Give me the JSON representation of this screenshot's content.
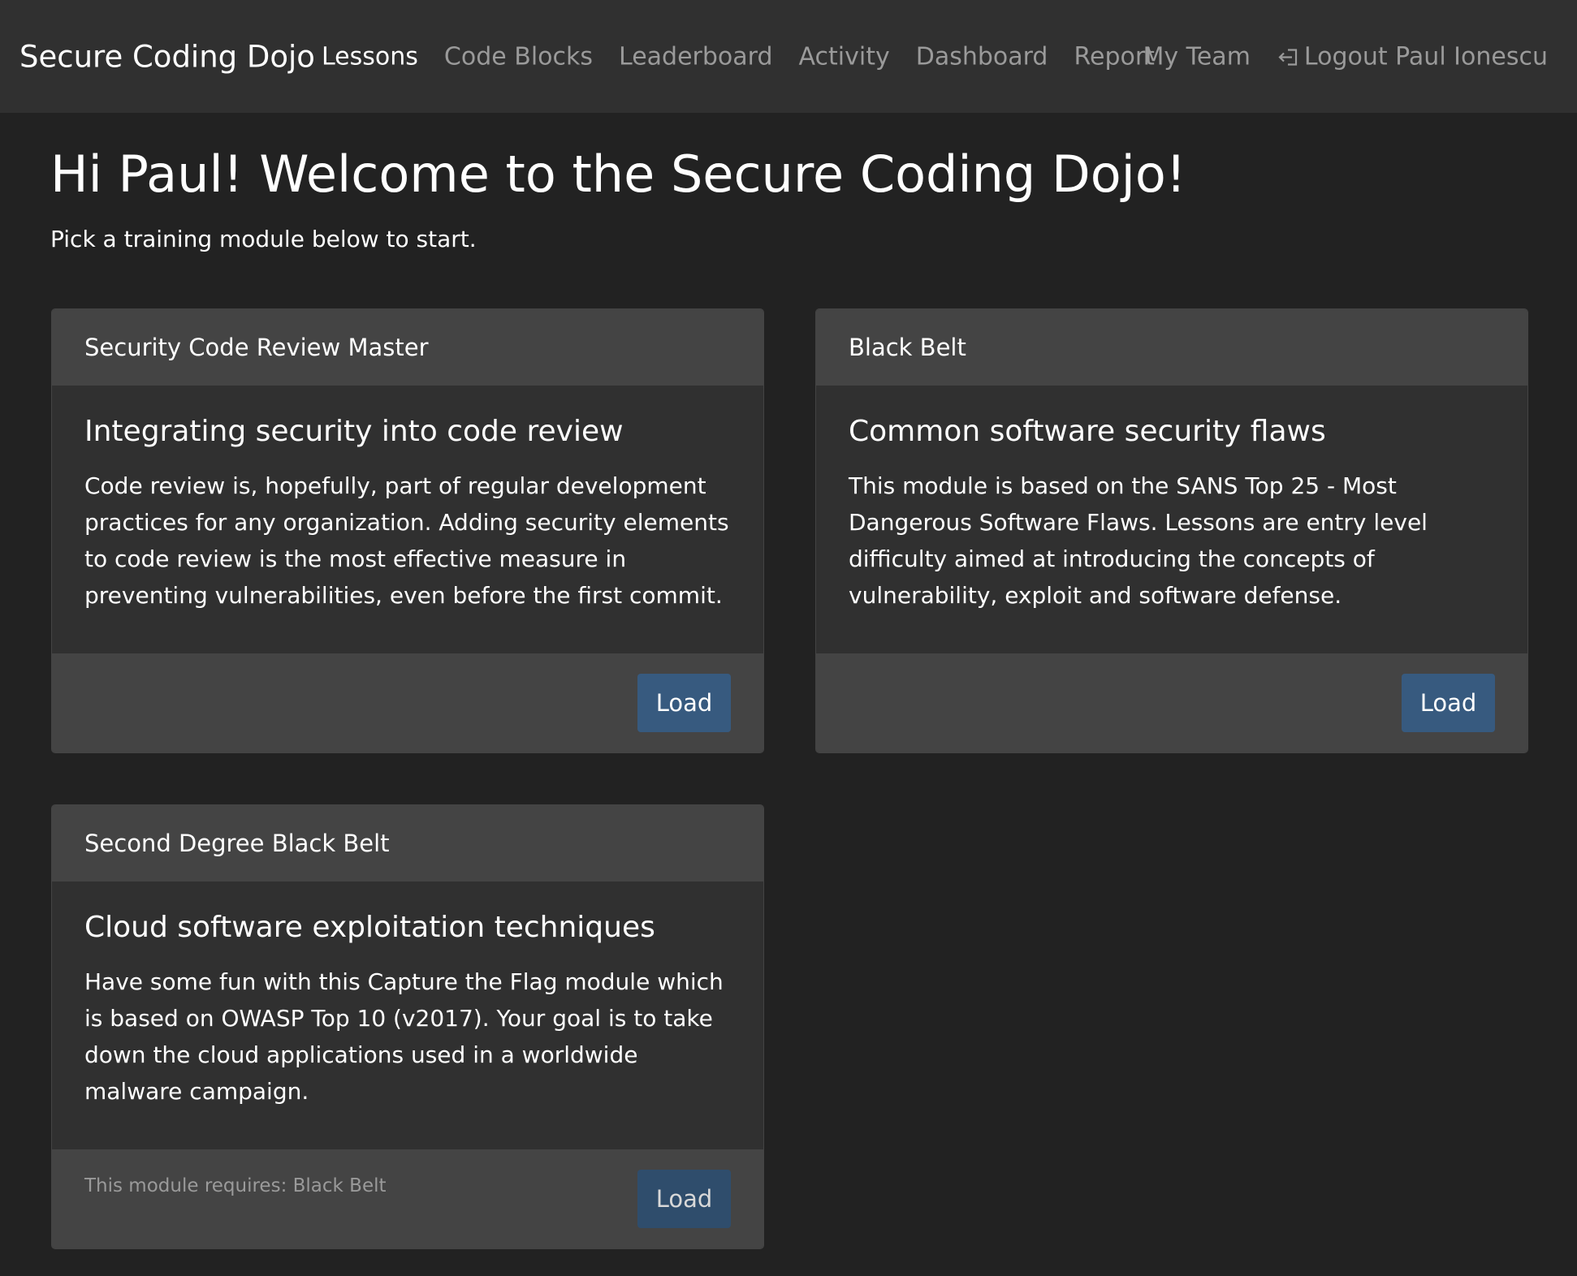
{
  "navbar": {
    "brand": "Secure Coding Dojo",
    "links": [
      "Lessons",
      "Code Blocks",
      "Leaderboard",
      "Activity",
      "Dashboard",
      "Report"
    ],
    "active": "Lessons",
    "my_team": "My Team",
    "logout": "Logout Paul Ionescu",
    "logout_icon": "sign-out-icon"
  },
  "welcome": {
    "title": "Hi Paul! Welcome to the Secure Coding Dojo!",
    "subtitle": "Pick a training module below to start."
  },
  "modules": [
    {
      "header": "Security Code Review Master",
      "title": "Integrating security into code review",
      "text": "Code review is, hopefully, part of regular development practices for any organization. Adding security elements to code review is the most effective measure in preventing vulnerabilities, even before the first commit.",
      "button": "Load",
      "requires": ""
    },
    {
      "header": "Black Belt",
      "title": "Common software security flaws",
      "text": "This module is based on the SANS Top 25 - Most Dangerous Software Flaws. Lessons are entry level difficulty aimed at introducing the concepts of vulnerability, exploit and software defense.",
      "button": "Load",
      "requires": ""
    },
    {
      "header": "Second Degree Black Belt",
      "title": "Cloud software exploitation techniques",
      "text": "Have some fun with this Capture the Flag module which is based on OWASP Top 10 (v2017). Your goal is to take down the cloud applications used in a worldwide malware campaign.",
      "button": "Load",
      "requires": "This module requires: Black Belt"
    }
  ],
  "colors": {
    "background": "#222222",
    "navbar": "#303030",
    "card_header": "#444444",
    "card_body": "#303030",
    "button": "#375a7f"
  }
}
